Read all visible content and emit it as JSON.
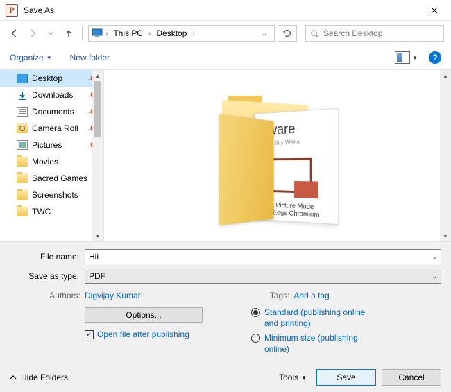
{
  "title": "Save As",
  "app_icon_letter": "P",
  "breadcrumb": {
    "root": "This PC",
    "folder": "Desktop"
  },
  "search": {
    "placeholder": "Search Desktop"
  },
  "toolbar": {
    "organize": "Organize",
    "new_folder": "New folder"
  },
  "sidebar": {
    "items": [
      {
        "label": "Desktop",
        "icon": "desktop",
        "pinned": true,
        "selected": true
      },
      {
        "label": "Downloads",
        "icon": "download",
        "pinned": true
      },
      {
        "label": "Documents",
        "icon": "document",
        "pinned": true
      },
      {
        "label": "Camera Roll",
        "icon": "camera",
        "pinned": true
      },
      {
        "label": "Pictures",
        "icon": "picture",
        "pinned": true
      },
      {
        "label": "Movies",
        "icon": "folder"
      },
      {
        "label": "Sacred Games",
        "icon": "folder"
      },
      {
        "label": "Screenshots",
        "icon": "folder"
      },
      {
        "label": "TWC",
        "icon": "folder"
      }
    ]
  },
  "preview": {
    "title_fragment": "ftware",
    "subtitle_fragment": "le on this Webs",
    "line1": "re-In-Picture Mode",
    "line2": "soft Edge Chromium"
  },
  "form": {
    "file_name_label": "File name:",
    "file_name_value": "Hii",
    "save_type_label": "Save as type:",
    "save_type_value": "PDF",
    "authors_label": "Authors:",
    "authors_value": "Digvijay Kumar",
    "tags_label": "Tags:",
    "tags_value": "Add a tag",
    "options_button": "Options...",
    "open_after_label": "Open file after publishing",
    "radio_standard": "Standard (publishing online and printing)",
    "radio_minimum": "Minimum size (publishing online)"
  },
  "footer": {
    "hide_folders": "Hide Folders",
    "tools": "Tools",
    "save": "Save",
    "cancel": "Cancel"
  }
}
